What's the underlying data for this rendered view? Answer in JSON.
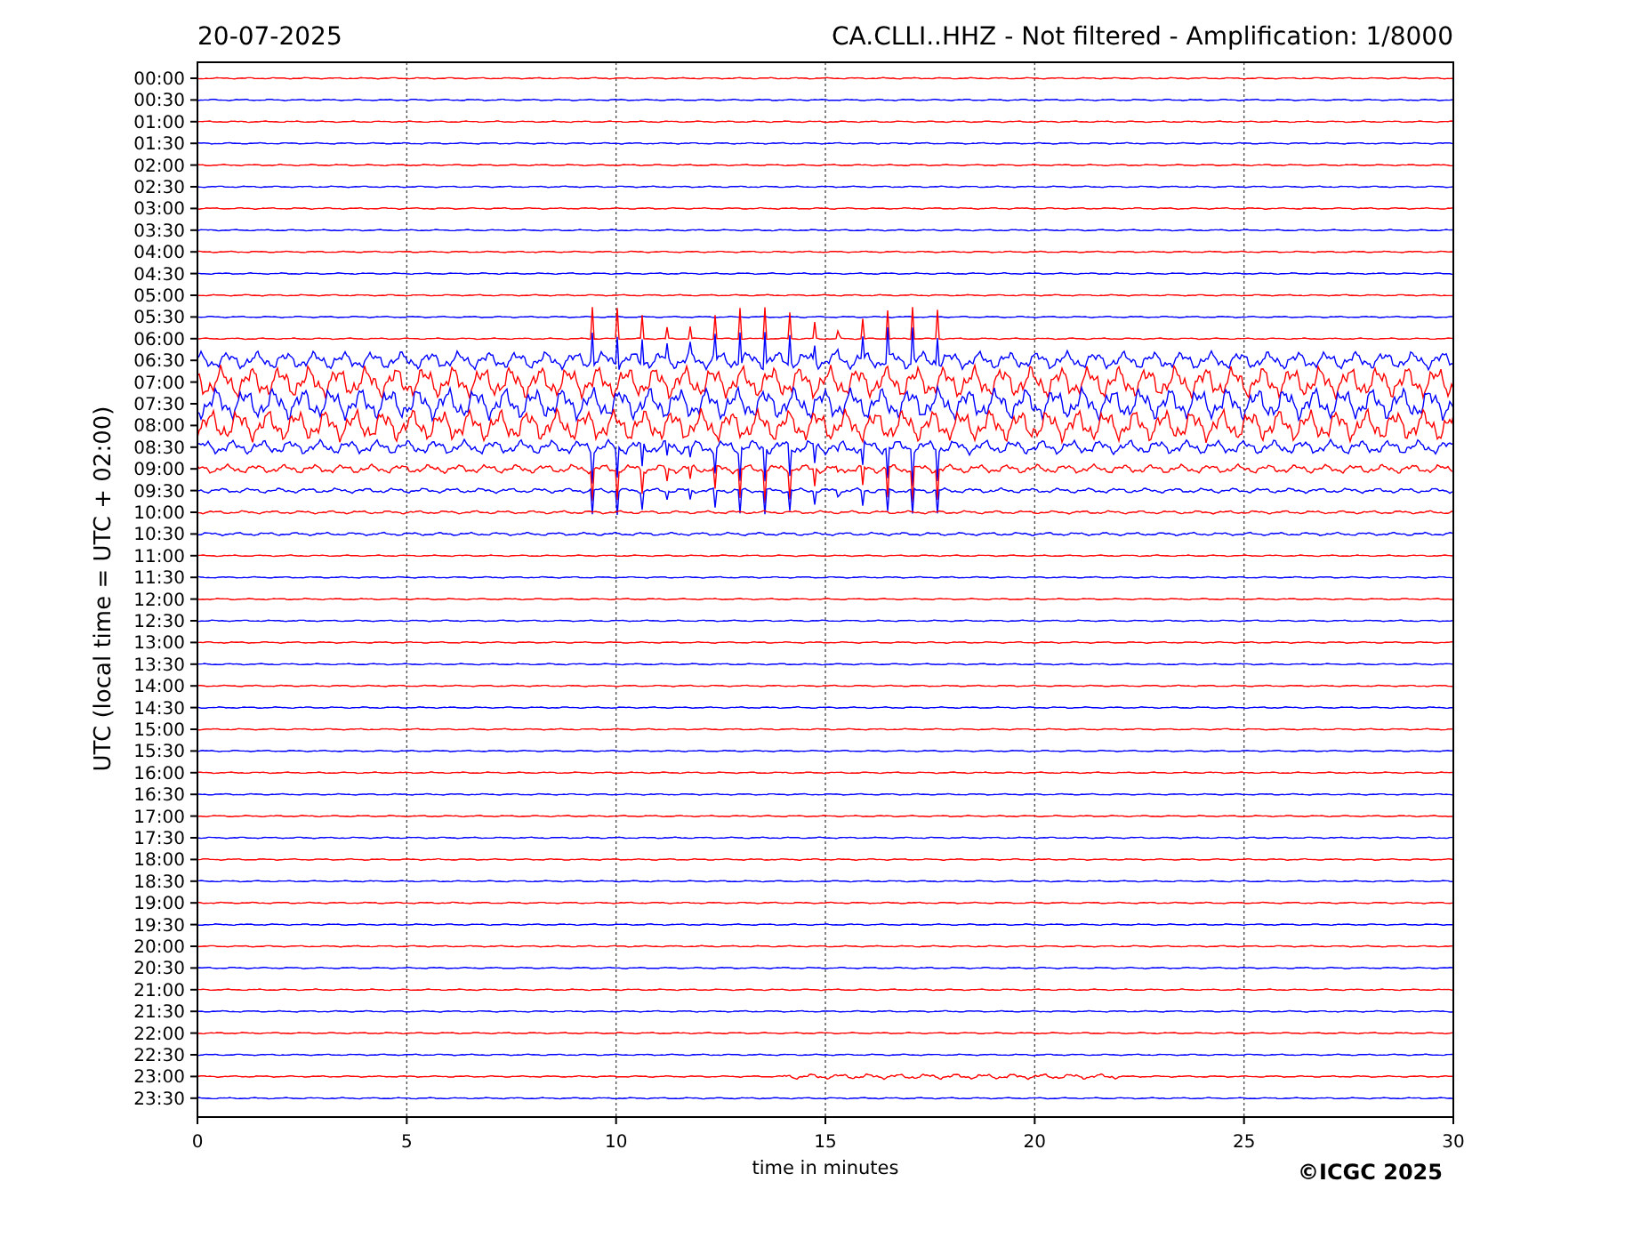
{
  "header": {
    "date": "20-07-2025",
    "title": "CA.CLLI..HHZ - Not filtered - Amplification: 1/8000"
  },
  "plot": {
    "ylabel": "UTC (local time = UTC + 02:00)",
    "xlabel": "time in minutes",
    "xticks": [
      "0",
      "5",
      "10",
      "15",
      "20",
      "25",
      "30"
    ],
    "traces": [
      {
        "label": "00:00",
        "color": "#ff0000"
      },
      {
        "label": "00:30",
        "color": "#0000ff"
      },
      {
        "label": "01:00",
        "color": "#ff0000"
      },
      {
        "label": "01:30",
        "color": "#0000ff"
      },
      {
        "label": "02:00",
        "color": "#ff0000"
      },
      {
        "label": "02:30",
        "color": "#0000ff"
      },
      {
        "label": "03:00",
        "color": "#ff0000"
      },
      {
        "label": "03:30",
        "color": "#0000ff"
      },
      {
        "label": "04:00",
        "color": "#ff0000"
      },
      {
        "label": "04:30",
        "color": "#0000ff"
      },
      {
        "label": "05:00",
        "color": "#ff0000"
      },
      {
        "label": "05:30",
        "color": "#0000ff"
      },
      {
        "label": "06:00",
        "color": "#ff0000"
      },
      {
        "label": "06:30",
        "color": "#0000ff"
      },
      {
        "label": "07:00",
        "color": "#ff0000"
      },
      {
        "label": "07:30",
        "color": "#0000ff"
      },
      {
        "label": "08:00",
        "color": "#ff0000"
      },
      {
        "label": "08:30",
        "color": "#0000ff"
      },
      {
        "label": "09:00",
        "color": "#ff0000"
      },
      {
        "label": "09:30",
        "color": "#0000ff"
      },
      {
        "label": "10:00",
        "color": "#ff0000"
      },
      {
        "label": "10:30",
        "color": "#0000ff"
      },
      {
        "label": "11:00",
        "color": "#ff0000"
      },
      {
        "label": "11:30",
        "color": "#0000ff"
      },
      {
        "label": "12:00",
        "color": "#ff0000"
      },
      {
        "label": "12:30",
        "color": "#0000ff"
      },
      {
        "label": "13:00",
        "color": "#ff0000"
      },
      {
        "label": "13:30",
        "color": "#0000ff"
      },
      {
        "label": "14:00",
        "color": "#ff0000"
      },
      {
        "label": "14:30",
        "color": "#0000ff"
      },
      {
        "label": "15:00",
        "color": "#ff0000"
      },
      {
        "label": "15:30",
        "color": "#0000ff"
      },
      {
        "label": "16:00",
        "color": "#ff0000"
      },
      {
        "label": "16:30",
        "color": "#0000ff"
      },
      {
        "label": "17:00",
        "color": "#ff0000"
      },
      {
        "label": "17:30",
        "color": "#0000ff"
      },
      {
        "label": "18:00",
        "color": "#ff0000"
      },
      {
        "label": "18:30",
        "color": "#0000ff"
      },
      {
        "label": "19:00",
        "color": "#ff0000"
      },
      {
        "label": "19:30",
        "color": "#0000ff"
      },
      {
        "label": "20:00",
        "color": "#ff0000"
      },
      {
        "label": "20:30",
        "color": "#0000ff"
      },
      {
        "label": "21:00",
        "color": "#ff0000"
      },
      {
        "label": "21:30",
        "color": "#0000ff"
      },
      {
        "label": "22:00",
        "color": "#ff0000"
      },
      {
        "label": "22:30",
        "color": "#0000ff"
      },
      {
        "label": "23:00",
        "color": "#ff0000"
      },
      {
        "label": "23:30",
        "color": "#0000ff"
      }
    ]
  },
  "copyright": "©ICGC 2025"
}
